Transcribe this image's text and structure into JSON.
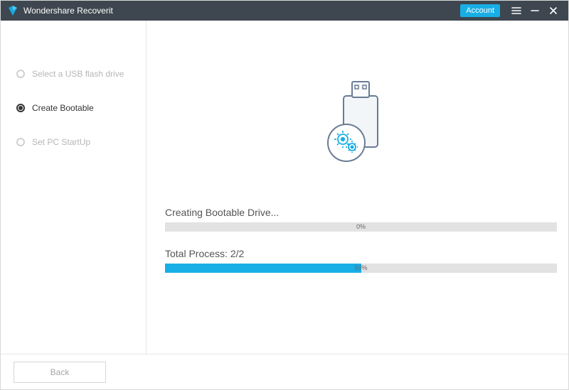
{
  "titlebar": {
    "app_name": "Wondershare Recoverit",
    "account_label": "Account"
  },
  "sidebar": {
    "steps": [
      {
        "label": "Select a USB flash drive",
        "state": "inactive"
      },
      {
        "label": "Create Bootable",
        "state": "active"
      },
      {
        "label": "Set PC StartUp",
        "state": "inactive"
      }
    ]
  },
  "progress": {
    "task_label": "Creating Bootable Drive...",
    "task_percent": 0,
    "task_percent_text": "0%",
    "total_label": "Total Process: 2/2",
    "total_percent": 50,
    "total_percent_text": "50%"
  },
  "footer": {
    "back_label": "Back"
  },
  "colors": {
    "accent": "#18aee6",
    "titlebar_bg": "#3e4750",
    "bar_bg": "#e2e2e2"
  }
}
